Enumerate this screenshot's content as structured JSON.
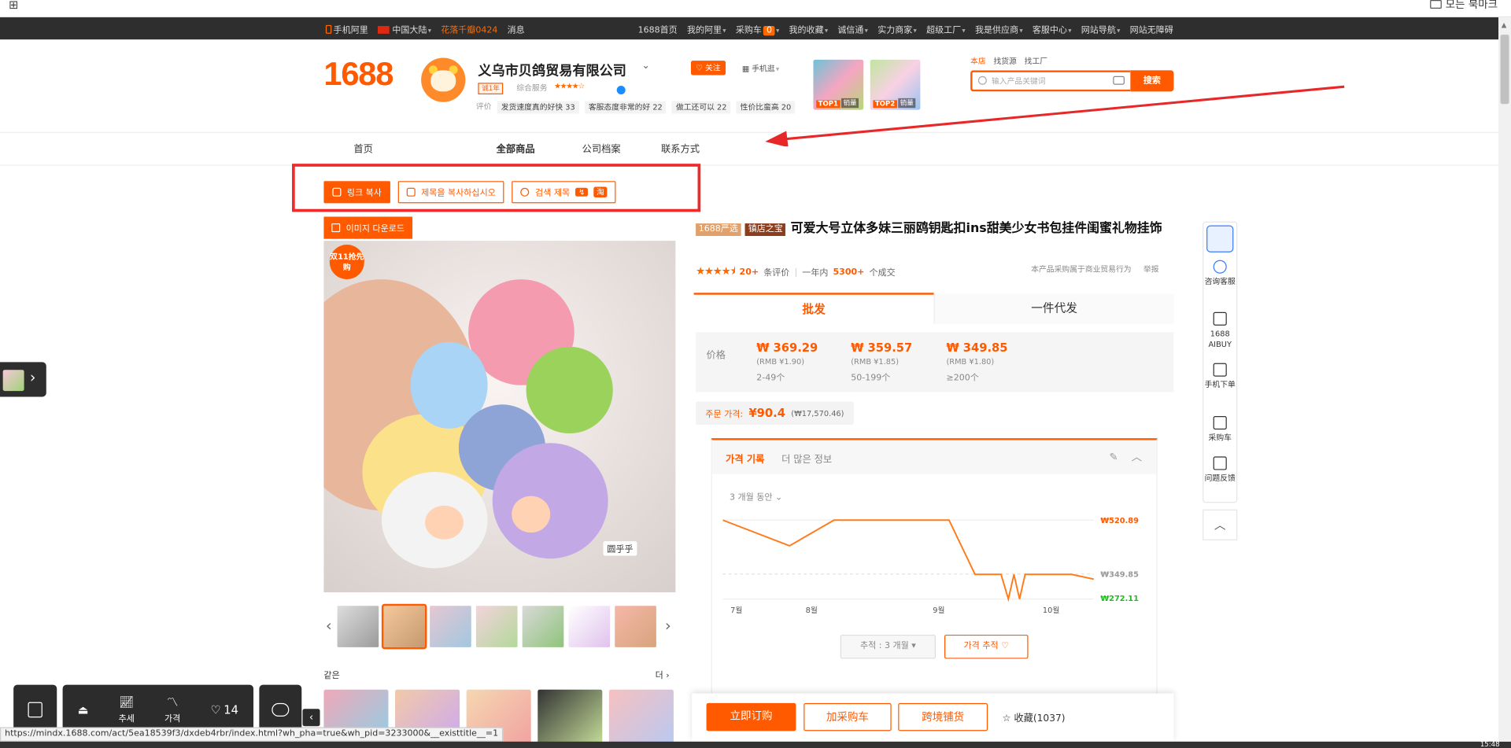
{
  "browser": {
    "bookmarks_label": "모든 북마크"
  },
  "topbar": {
    "mobile_ali": "手机阿里",
    "region": "中国大陆",
    "promo": "花落千瓣0424",
    "messages": "消息",
    "links": [
      "1688首页",
      "我的阿里",
      "采购车",
      "我的收藏",
      "诚信通",
      "实力商家",
      "超级工厂",
      "我是供应商",
      "客服中心",
      "网站导航",
      "网站无障碍"
    ],
    "cart_count": "0"
  },
  "header": {
    "logo": "1688",
    "company": "义乌市贝鸽贸易有限公司",
    "years_badge": "诚1年",
    "service_label": "综合服务",
    "stars": "★★★★☆",
    "reviews_label": "评价",
    "review_tags": [
      "发货速度真的好快 33",
      "客服态度非常的好 22",
      "做工还可以 22",
      "性价比蛮高 20"
    ],
    "follow": "关注",
    "mobile_shop": "手机逛",
    "top_badges": [
      {
        "rank": "TOP1",
        "label": "销量"
      },
      {
        "rank": "TOP2",
        "label": "销量"
      }
    ]
  },
  "search": {
    "tabs": [
      "本店",
      "找货源",
      "找工厂"
    ],
    "placeholder": "输入产品关键词",
    "button": "搜索"
  },
  "nav": {
    "home": "首页",
    "all_products": "全部商品",
    "profile": "公司档案",
    "contact": "联系方式"
  },
  "tools": {
    "copy_link": "링크 복사",
    "copy_title": "제목을 복사하십시오",
    "search_title": "검색 제목",
    "taobao_badge": "淘",
    "image_download": "이미지 다운로드"
  },
  "gallery": {
    "promo_tag": "双11抢先购",
    "watermark": "圆乎乎",
    "similar_label": "같은",
    "similar_more": "더"
  },
  "product": {
    "badge_yanxuan": "1688严选",
    "badge_shop": "镇店之宝",
    "title": "可爱大号立体多妹三丽鸥钥匙扣ins甜美少女书包挂件闺蜜礼物挂饰",
    "rating": 4.5,
    "review_count": "20+",
    "review_suffix": "条评价",
    "year_label": "一年内",
    "sold": "5300+",
    "sold_suffix": "个成交",
    "notice": "本产品采购属于商业贸易行为",
    "report": "举报",
    "tab_wholesale": "批发",
    "tab_dropship": "一件代发",
    "price_label": "价格",
    "tiers": [
      {
        "price": "₩ 369.29",
        "rmb": "(RMB ¥1.90)",
        "qty": "2-49个"
      },
      {
        "price": "₩ 359.57",
        "rmb": "(RMB ¥1.85)",
        "qty": "50-199个"
      },
      {
        "price": "₩ 349.85",
        "rmb": "(RMB ¥1.80)",
        "qty": "≥200个"
      }
    ],
    "order_price_label": "주문 가격:",
    "order_price": "¥90.4",
    "order_price_krw": "(₩17,570.46)"
  },
  "history": {
    "tab_history": "가격 기록",
    "tab_more": "더 많은 정보",
    "range": "3 개월 동안",
    "track_select": "추적 : 3 개월",
    "track_button": "가격 추적"
  },
  "chart_data": {
    "type": "line",
    "x_ticks": [
      "7월",
      "8월",
      "9월",
      "10월"
    ],
    "labels": {
      "max": "₩520.89",
      "current": "₩349.85",
      "min": "₩272.11"
    },
    "ylim": [
      272.11,
      520.89
    ],
    "series": [
      {
        "values": [
          [
            0,
            520.89
          ],
          [
            0.18,
            440
          ],
          [
            0.3,
            520.89
          ],
          [
            0.61,
            520.89
          ],
          [
            0.68,
            349.85
          ],
          [
            0.75,
            349.85
          ],
          [
            0.77,
            272.11
          ],
          [
            0.785,
            349.85
          ],
          [
            0.8,
            272.11
          ],
          [
            0.815,
            349.85
          ],
          [
            0.94,
            349.85
          ],
          [
            1.0,
            335
          ]
        ]
      }
    ],
    "colors": {
      "line": "#ff7b1c",
      "max": "#ff5a00",
      "current": "#999999",
      "min": "#22bb22"
    }
  },
  "actions": {
    "buy_now": "立即订购",
    "add_cart": "加采购车",
    "cross_border": "跨境铺货",
    "favorite": "收藏(1037)"
  },
  "right_bar": {
    "consult": "咨询客服",
    "aibuy": "1688 AIBUY",
    "mobile_order": "手机下单",
    "cart": "采购车",
    "feedback": "问题反馈"
  },
  "bottom_toolbar": {
    "trend": "추세",
    "price": "가격",
    "likes": "14"
  },
  "status_url": "https://mindx.1688.com/act/5ea18539f3/dxdeb4rbr/index.html?wh_pha=true&wh_pid=3233000&__existtitle__=1",
  "clock": "15:48"
}
